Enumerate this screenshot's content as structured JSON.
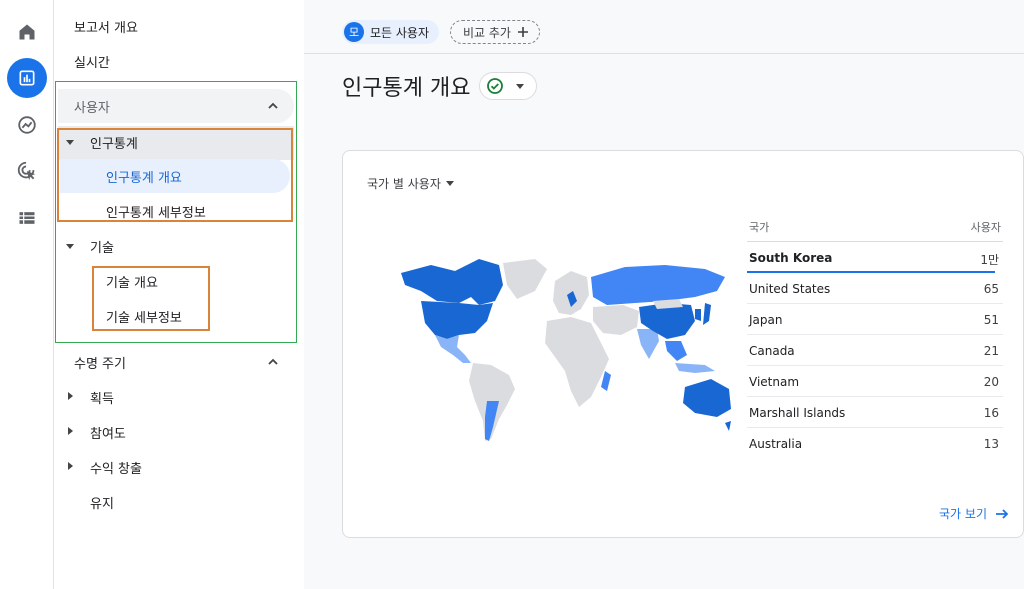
{
  "colors": {
    "accent": "#1a73e8",
    "dark_blue": "#1967d2",
    "mid_blue": "#4285f4",
    "light_blue": "#8ab4f8",
    "gray_land": "#dadce0",
    "green_box": "#34a853",
    "orange_box": "#d9843b"
  },
  "nav": {
    "report_overview": "보고서 개요",
    "realtime": "실시간",
    "user_section": "사용자",
    "demographics": "인구통계",
    "demographics_overview": "인구통계 개요",
    "demographics_details": "인구통계 세부정보",
    "tech": "기술",
    "tech_overview": "기술 개요",
    "tech_details": "기술 세부정보",
    "lifecycle": "수명 주기",
    "acquisition": "획득",
    "engagement": "참여도",
    "monetization": "수익 창출",
    "retention": "유지"
  },
  "topbar": {
    "all_users_avatar": "모",
    "all_users": "모든 사용자",
    "add_comparison": "비교 추가"
  },
  "page": {
    "title": "인구통계 개요"
  },
  "card": {
    "title": "국가 별 사용자",
    "col_country": "국가",
    "col_users": "사용자",
    "rows": [
      {
        "country": "South Korea",
        "users": "1만"
      },
      {
        "country": "United States",
        "users": "65"
      },
      {
        "country": "Japan",
        "users": "51"
      },
      {
        "country": "Canada",
        "users": "21"
      },
      {
        "country": "Vietnam",
        "users": "20"
      },
      {
        "country": "Marshall Islands",
        "users": "16"
      },
      {
        "country": "Australia",
        "users": "13"
      }
    ],
    "view_countries": "국가 보기"
  }
}
